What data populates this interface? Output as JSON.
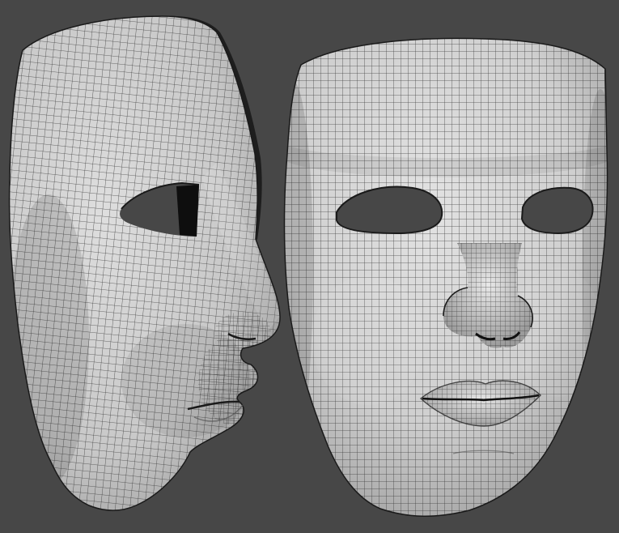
{
  "scene": {
    "background_color": "#474747",
    "mesh_fill_color": "#d7d7d7",
    "mesh_shadow_color": "#8e8e8e",
    "wire_color": "#2a2a2a",
    "hole_color": "#111111",
    "objects": [
      {
        "name": "mask-side-view",
        "view": "profile"
      },
      {
        "name": "mask-front-view",
        "view": "front"
      }
    ]
  }
}
